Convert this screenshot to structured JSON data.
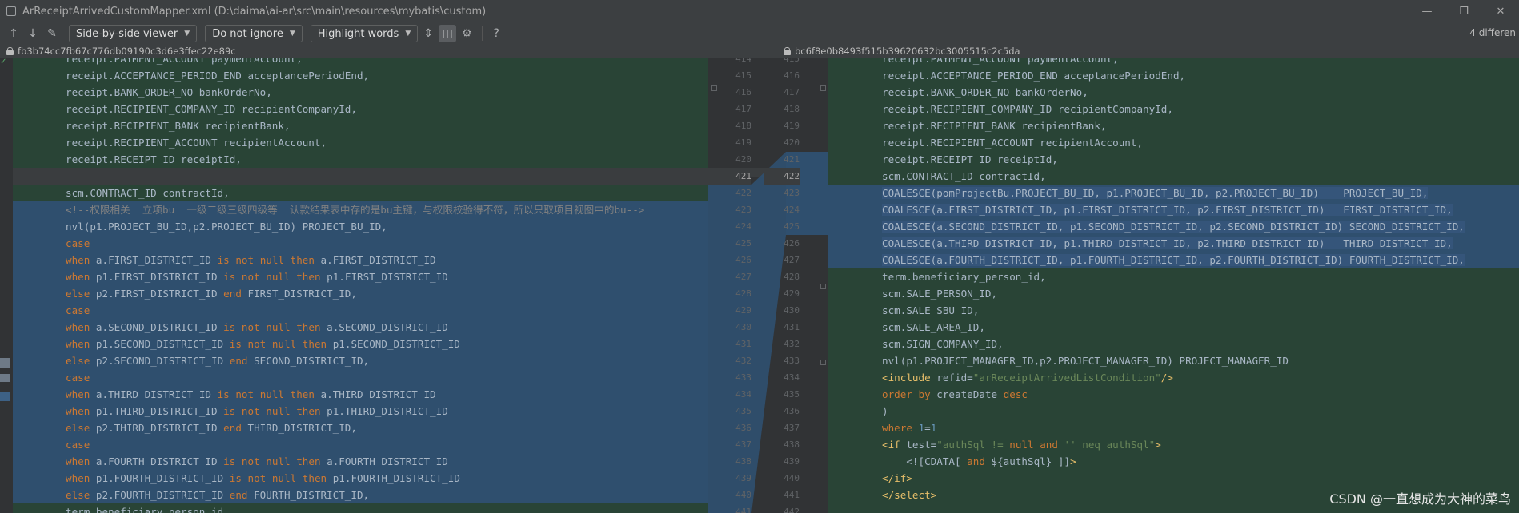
{
  "window": {
    "title": "ArReceiptArrivedCustomMapper.xml (D:\\daima\\ai-ar\\src\\main\\resources\\mybatis\\custom)",
    "controls": [
      "—",
      "❐",
      "✕"
    ]
  },
  "toolbar": {
    "viewer": "Side-by-side viewer",
    "ignore": "Do not ignore",
    "highlight": "Highlight words",
    "differences": "4 differen"
  },
  "revisions": {
    "left": "fb3b74cc7fb67c776db09190c3d6e3ffec22e89c",
    "right": "bc6f8e0b8493f515b39620632bc3005515c2c5da"
  },
  "left_gutter_numbers": [
    "414",
    "415",
    "416",
    "417",
    "418",
    "419",
    "420",
    "421",
    "422",
    "423",
    "424",
    "425",
    "426",
    "427",
    "428",
    "429",
    "430",
    "431",
    "432",
    "433",
    "434",
    "435",
    "436",
    "437",
    "438",
    "439",
    "440",
    "441"
  ],
  "right_gutter_numbers": [
    "415",
    "416",
    "417",
    "418",
    "419",
    "420",
    "421",
    "422",
    "423",
    "424",
    "425",
    "426",
    "427",
    "428",
    "429",
    "430",
    "431",
    "432",
    "433",
    "434",
    "435",
    "436",
    "437",
    "438",
    "439",
    "440",
    "441",
    "442"
  ],
  "left_lines": [
    "receipt.PAYMENT_ACCOUNT paymentAccount,",
    "receipt.ACCEPTANCE_PERIOD_END acceptancePeriodEnd,",
    "receipt.BANK_ORDER_NO bankOrderNo,",
    "receipt.RECIPIENT_COMPANY_ID recipientCompanyId,",
    "receipt.RECIPIENT_BANK recipientBank,",
    "receipt.RECIPIENT_ACCOUNT recipientAccount,",
    "receipt.RECEIPT_ID receiptId,",
    "",
    "scm.CONTRACT_ID contractId,",
    "<!--权限相关  立项bu  一级二级三级四级等  认款结果表中存的是bu主键，与权限校验得不符，所以只取项目视图中的bu-->",
    "nvl(p1.PROJECT_BU_ID,p2.PROJECT_BU_ID) PROJECT_BU_ID,",
    "case",
    "when a.FIRST_DISTRICT_ID is not null then a.FIRST_DISTRICT_ID",
    "when p1.FIRST_DISTRICT_ID is not null then p1.FIRST_DISTRICT_ID",
    "else p2.FIRST_DISTRICT_ID end FIRST_DISTRICT_ID,",
    "case",
    "when a.SECOND_DISTRICT_ID is not null then a.SECOND_DISTRICT_ID",
    "when p1.SECOND_DISTRICT_ID is not null then p1.SECOND_DISTRICT_ID",
    "else p2.SECOND_DISTRICT_ID end SECOND_DISTRICT_ID,",
    "case",
    "when a.THIRD_DISTRICT_ID is not null then a.THIRD_DISTRICT_ID",
    "when p1.THIRD_DISTRICT_ID is not null then p1.THIRD_DISTRICT_ID",
    "else p2.THIRD_DISTRICT_ID end THIRD_DISTRICT_ID,",
    "case",
    "when a.FOURTH_DISTRICT_ID is not null then a.FOURTH_DISTRICT_ID",
    "when p1.FOURTH_DISTRICT_ID is not null then p1.FOURTH_DISTRICT_ID",
    "else p2.FOURTH_DISTRICT_ID end FOURTH_DISTRICT_ID,",
    "term.beneficiary_person_id,"
  ],
  "right_lines": [
    "receipt.PAYMENT_ACCOUNT paymentAccount,",
    "receipt.ACCEPTANCE_PERIOD_END acceptancePeriodEnd,",
    "receipt.BANK_ORDER_NO bankOrderNo,",
    "receipt.RECIPIENT_COMPANY_ID recipientCompanyId,",
    "receipt.RECIPIENT_BANK recipientBank,",
    "receipt.RECIPIENT_ACCOUNT recipientAccount,",
    "receipt.RECEIPT_ID receiptId,",
    "scm.CONTRACT_ID contractId,",
    "COALESCE(pomProjectBu.PROJECT_BU_ID, p1.PROJECT_BU_ID, p2.PROJECT_BU_ID)    PROJECT_BU_ID,",
    "COALESCE(a.FIRST_DISTRICT_ID, p1.FIRST_DISTRICT_ID, p2.FIRST_DISTRICT_ID)   FIRST_DISTRICT_ID,",
    "COALESCE(a.SECOND_DISTRICT_ID, p1.SECOND_DISTRICT_ID, p2.SECOND_DISTRICT_ID) SECOND_DISTRICT_ID,",
    "COALESCE(a.THIRD_DISTRICT_ID, p1.THIRD_DISTRICT_ID, p2.THIRD_DISTRICT_ID)   THIRD_DISTRICT_ID,",
    "COALESCE(a.FOURTH_DISTRICT_ID, p1.FOURTH_DISTRICT_ID, p2.FOURTH_DISTRICT_ID) FOURTH_DISTRICT_ID,",
    "term.beneficiary_person_id,",
    "scm.SALE_PERSON_ID,",
    "scm.SALE_SBU_ID,",
    "scm.SALE_AREA_ID,",
    "scm.SIGN_COMPANY_ID,",
    "nvl(p1.PROJECT_MANAGER_ID,p2.PROJECT_MANAGER_ID) PROJECT_MANAGER_ID",
    "<include refid=\"arReceiptArrivedListCondition\"/>",
    "order by createDate desc",
    ")",
    "where 1=1",
    "<if test=\"authSql != null and '' neq authSql\">",
    "    <![CDATA[ and ${authSql} ]]>",
    "</if>",
    "</select>",
    ""
  ],
  "watermark": "CSDN @一直想成为大神的菜鸟"
}
